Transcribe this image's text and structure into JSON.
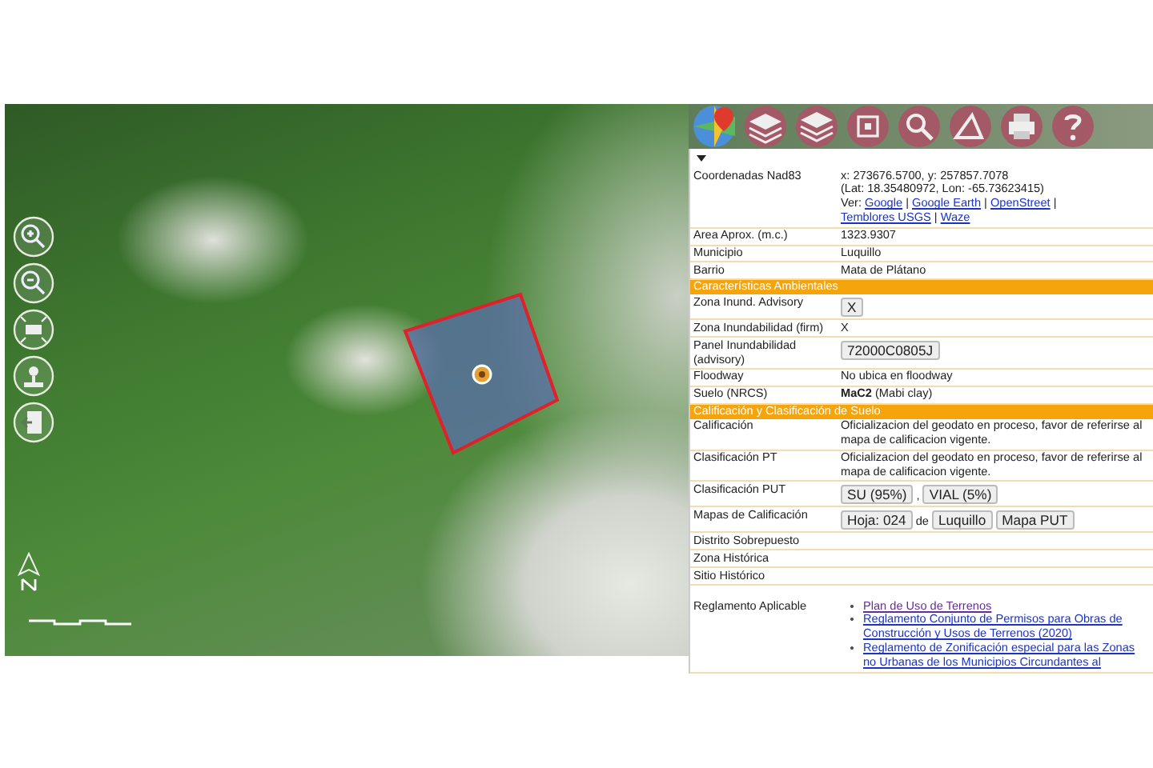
{
  "info": {
    "rows": [
      {
        "kind": "field",
        "label": "Coordenadas Nad83",
        "parts": [
          {
            "kind": "text",
            "text": "x: 273676.5700, y: 257857.7078"
          },
          {
            "kind": "break"
          },
          {
            "kind": "text",
            "text": "(Lat: 18.35480972, Lon: -65.73623415)"
          },
          {
            "kind": "break"
          },
          {
            "kind": "text",
            "text": "Ver:"
          },
          {
            "kind": "link",
            "text": "Google"
          },
          {
            "kind": "text",
            "text": "|"
          },
          {
            "kind": "link",
            "text": "Google Earth"
          },
          {
            "kind": "text",
            "text": "|"
          },
          {
            "kind": "link",
            "text": "OpenStreet"
          },
          {
            "kind": "text",
            "text": "|"
          },
          {
            "kind": "link",
            "text": "Temblores USGS"
          },
          {
            "kind": "text",
            "text": "|"
          },
          {
            "kind": "link",
            "text": "Waze"
          }
        ]
      },
      {
        "kind": "field",
        "label": "Area Aprox. (m.c.)",
        "parts": [
          {
            "kind": "text",
            "text": "1323.9307"
          }
        ]
      },
      {
        "kind": "field",
        "label": "Municipio",
        "parts": [
          {
            "kind": "text",
            "text": "Luquillo"
          }
        ]
      },
      {
        "kind": "field",
        "label": "Barrio",
        "parts": [
          {
            "kind": "text",
            "text": "Mata de Plátano"
          }
        ]
      },
      {
        "kind": "header",
        "text": "Características Ambientales"
      },
      {
        "kind": "field",
        "label": "Zona Inund. Advisory",
        "parts": [
          {
            "kind": "button",
            "text": "X"
          }
        ]
      },
      {
        "kind": "field",
        "label": "Zona Inundabilidad (firm)",
        "parts": [
          {
            "kind": "text",
            "text": "X"
          }
        ]
      },
      {
        "kind": "field",
        "label": "Panel Inundabilidad (advisory)",
        "parts": [
          {
            "kind": "button",
            "text": "72000C0805J"
          }
        ]
      },
      {
        "kind": "field",
        "label": "Floodway",
        "parts": [
          {
            "kind": "text",
            "text": "No ubica en floodway"
          }
        ]
      },
      {
        "kind": "field",
        "label": "Suelo (NRCS)",
        "parts": [
          {
            "kind": "text",
            "text": "**MaC2** (Mabi clay)"
          }
        ]
      },
      {
        "kind": "header",
        "text": "Calificación y Clasificación de Suelo"
      },
      {
        "kind": "field",
        "label": "Calificación",
        "parts": [
          {
            "kind": "text",
            "text": "Oficializacion del geodato en proceso, favor de referirse al mapa de calificacion vigente."
          }
        ]
      },
      {
        "kind": "field",
        "label": "Clasificación PT",
        "parts": [
          {
            "kind": "text",
            "text": "Oficializacion del geodato en proceso, favor de referirse al mapa de calificacion vigente."
          }
        ]
      },
      {
        "kind": "field",
        "label": "Clasificación PUT",
        "parts": [
          {
            "kind": "button",
            "text": "SU (95%)"
          },
          {
            "kind": "text",
            "text": ","
          },
          {
            "kind": "button",
            "text": "VIAL (5%)"
          }
        ]
      },
      {
        "kind": "field",
        "label": "Mapas de Calificación",
        "parts": [
          {
            "kind": "button",
            "text": "Hoja: 024"
          },
          {
            "kind": "text",
            "text": "de"
          },
          {
            "kind": "button",
            "text": "Luquillo"
          },
          {
            "kind": "button",
            "text": "Mapa PUT"
          }
        ]
      },
      {
        "kind": "field",
        "label": "Distrito Sobrepuesto",
        "parts": []
      },
      {
        "kind": "field",
        "label": "Zona Histórica",
        "parts": []
      },
      {
        "kind": "field",
        "label": "Sitio Histórico",
        "parts": []
      },
      {
        "kind": "list",
        "label": "Reglamento Aplicable",
        "items": [
          {
            "text": "Plan de Uso de Terrenos",
            "visited": true
          },
          {
            "text": "Reglamento Conjunto de Permisos para Obras de Construcción y Usos de Terrenos (2020)",
            "visited": false
          },
          {
            "text": "Reglamento de Zonificación especial para las Zonas no Urbanas de los Municipios Circundantes al",
            "visited": false
          }
        ]
      }
    ]
  }
}
